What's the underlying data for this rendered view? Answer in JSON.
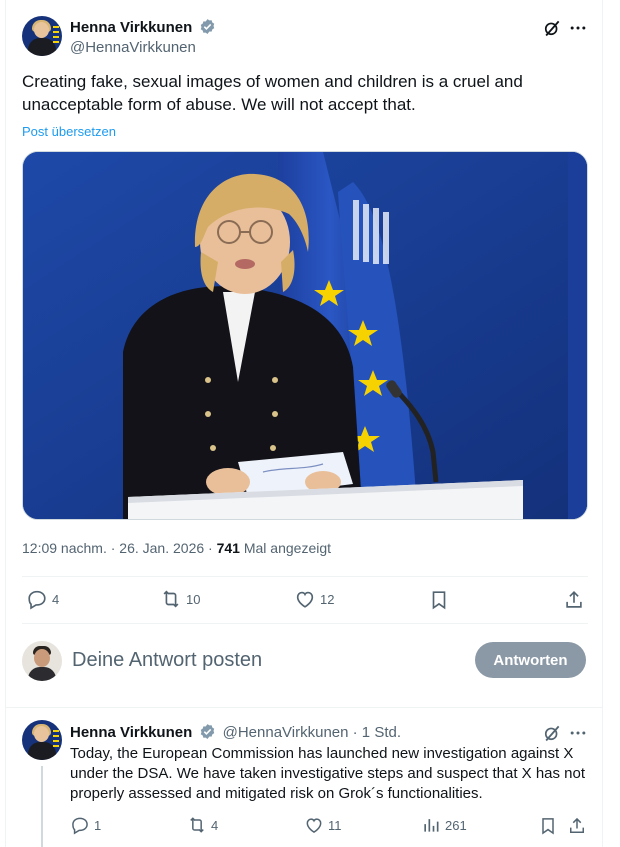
{
  "main_tweet": {
    "author_name": "Henna Virkkunen",
    "author_handle": "@HennaVirkkunen",
    "text": "Creating fake, sexual images of women and children is a cruel and unacceptable form of abuse. We will not accept that.",
    "translate_link": "Post übersetzen",
    "photo_alt": "Henna Virkkunen speaking at a podium in front of EU flags",
    "time": "12:09 nachm.",
    "date": "26. Jan. 2026",
    "separator": "·",
    "views_count": "741",
    "views_label": "Mal angezeigt",
    "actions": {
      "replies": "4",
      "reposts": "10",
      "likes": "12"
    }
  },
  "reply_composer": {
    "placeholder": "Deine Antwort posten",
    "button_label": "Antworten"
  },
  "thread_tweet": {
    "author_name": "Henna Virkkunen",
    "author_handle": "@HennaVirkkunen",
    "time_ago": "· 1 Std.",
    "text": "Today, the European Commission has launched new investigation against X under the DSA. We have taken investigative steps and suspect that X has not properly assessed and mitigated risk on Grok´s functionalities.",
    "actions": {
      "replies": "1",
      "reposts": "4",
      "likes": "11",
      "views": "261"
    }
  },
  "colors": {
    "accent": "#1d9bf0",
    "secondary_text": "#536471",
    "verified_badge": "#829aab",
    "disabled_button": "#8b98a5"
  },
  "icons": [
    "verified-badge-icon",
    "grok-icon",
    "more-icon",
    "reply-icon",
    "repost-icon",
    "like-icon",
    "bookmark-icon",
    "share-icon",
    "views-icon"
  ]
}
